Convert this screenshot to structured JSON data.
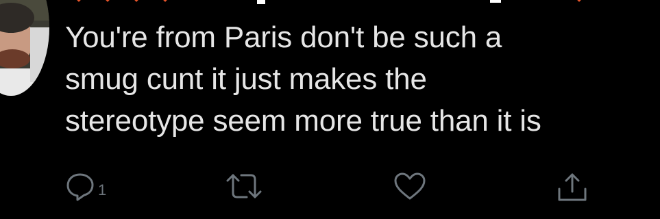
{
  "tweet": {
    "header_fragment": "",
    "text": "You're from Paris don't be such a\nsmug cunt it just makes the\nstereotype seem more true than it is",
    "actions": {
      "reply": {
        "icon": "reply-icon",
        "count": "1"
      },
      "retweet": {
        "icon": "retweet-icon"
      },
      "like": {
        "icon": "heart-icon"
      },
      "share": {
        "icon": "share-icon"
      }
    }
  },
  "colors": {
    "background": "#000000",
    "text": "#e6e6e6",
    "icon": "#6e767d",
    "emoji_accent": "#e8552b"
  }
}
